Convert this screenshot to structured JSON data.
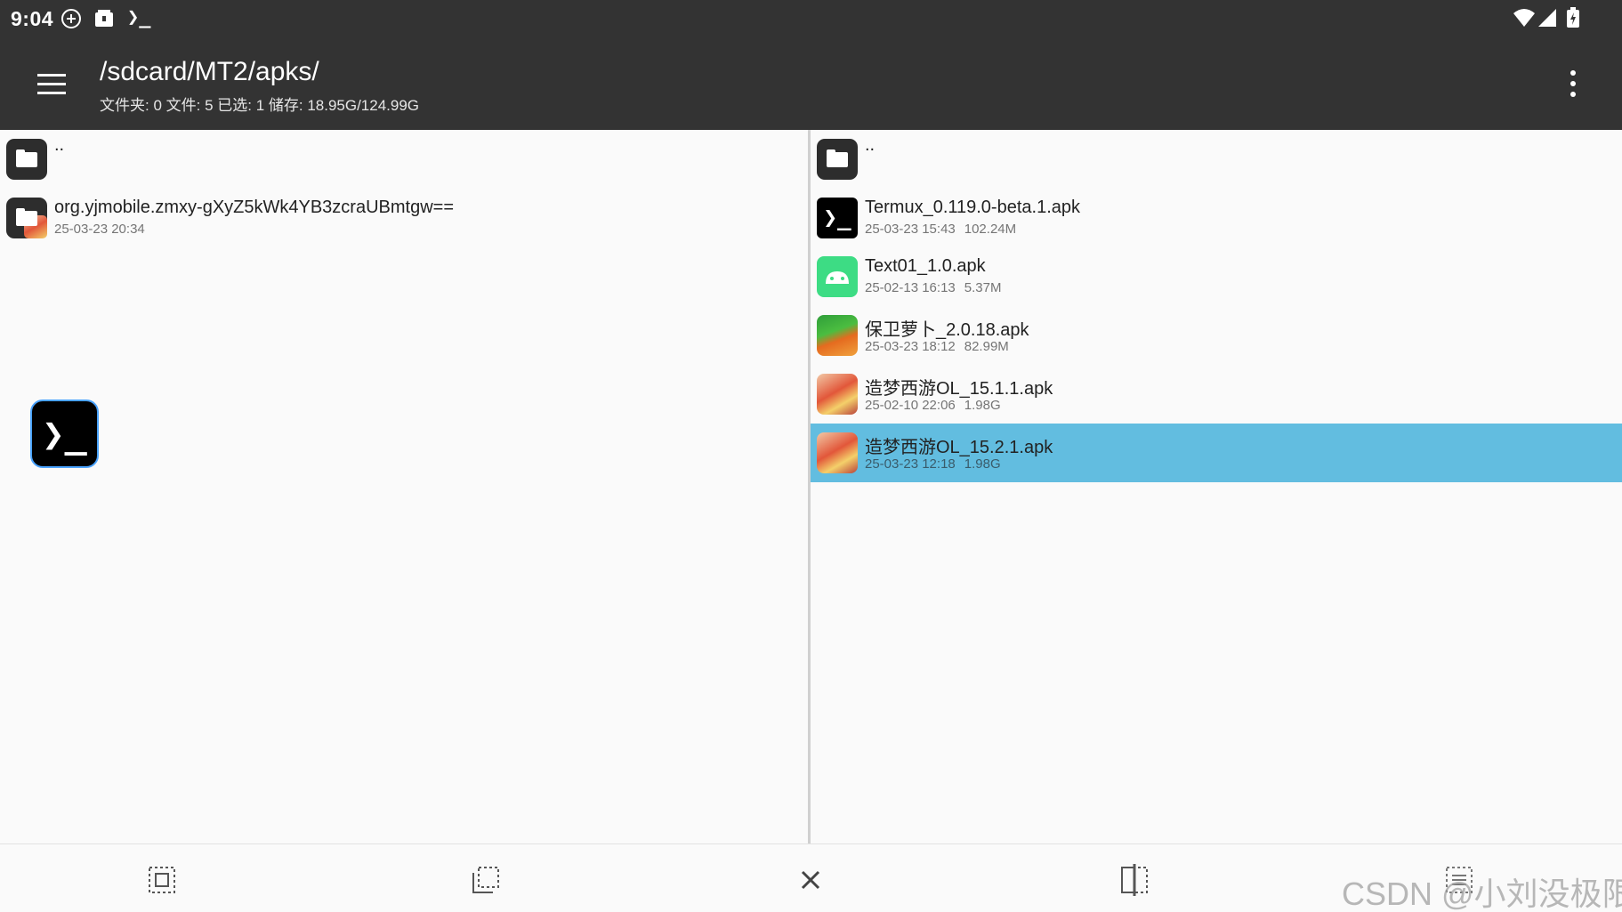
{
  "status_bar": {
    "time": "9:04",
    "icons": [
      "gamepad-icon",
      "box-icon",
      "terminal-icon",
      "wifi-icon",
      "signal-icon",
      "battery-icon"
    ],
    "terminal_glyph": "❯_"
  },
  "app_bar": {
    "title": "/sdcard/MT2/apks/",
    "subtitle": "文件夹: 0  文件: 5  已选: 1  储存: 18.95G/124.99G"
  },
  "left_pane": {
    "parent_label": "..",
    "items": [
      {
        "name": "org.yjmobile.zmxy-gXyZ5kWk4YB3zcraUBmtgw==",
        "date": "25-03-23 20:34",
        "icon": "folder-icon"
      }
    ],
    "floating_glyph": "❯_"
  },
  "right_pane": {
    "parent_label": "..",
    "items": [
      {
        "name": "Termux_0.119.0-beta.1.apk",
        "date": "25-03-23 15:43",
        "size": "102.24M",
        "icon": "terminal-app-icon",
        "glyph": "❯_"
      },
      {
        "name": "Text01_1.0.apk",
        "date": "25-02-13 16:13",
        "size": "5.37M",
        "icon": "android-app-icon"
      },
      {
        "name": "保卫萝卜_2.0.18.apk",
        "date": "25-03-23 18:12",
        "size": "82.99M",
        "icon": "carrot-game-icon"
      },
      {
        "name": "造梦西游OL_15.1.1.apk",
        "date": "25-02-10 22:06",
        "size": "1.98G",
        "icon": "game-app-icon"
      },
      {
        "name": "造梦西游OL_15.2.1.apk",
        "date": "25-03-23 12:18",
        "size": "1.98G",
        "icon": "game-app-icon",
        "selected": true
      }
    ]
  },
  "bottom_bar": {
    "buttons": [
      "select-all-icon",
      "select-range-icon",
      "close-icon",
      "split-view-icon",
      "list-icon"
    ],
    "watermark": "CSDN @小刘没极限"
  },
  "colors": {
    "bar_bg": "#333333",
    "selection": "#62bde0",
    "pane_bg": "#fafafa"
  }
}
